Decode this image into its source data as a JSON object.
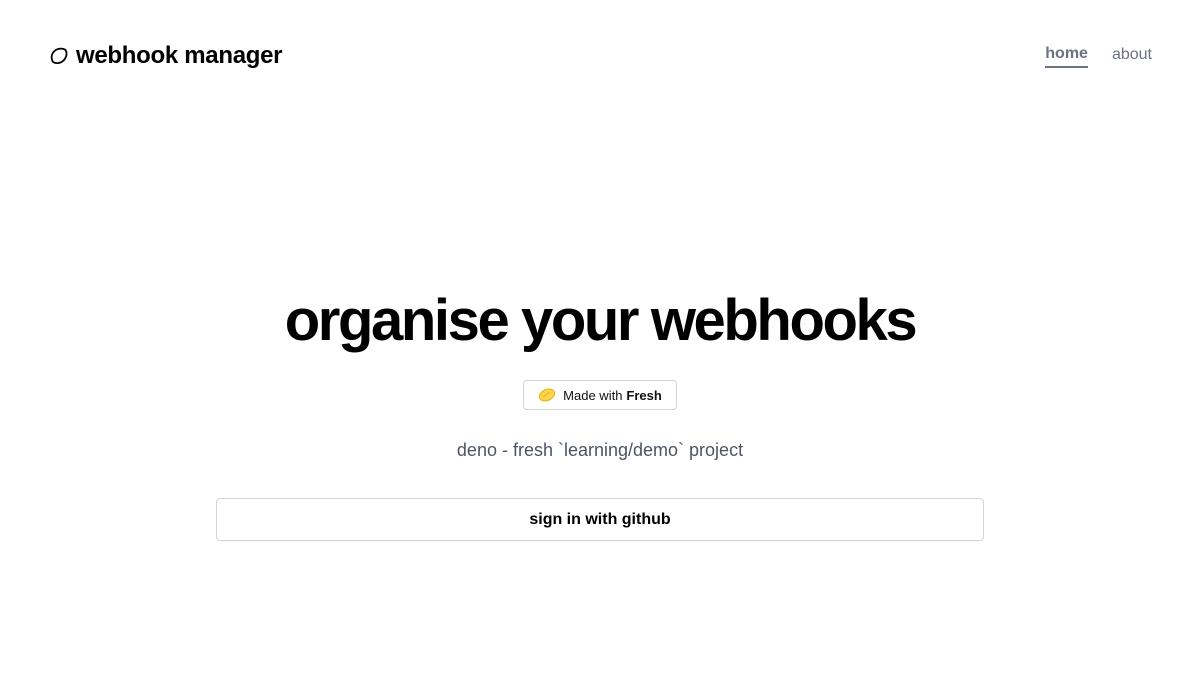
{
  "header": {
    "brand_title": "webhook manager",
    "brand_icon": "lemon-outline-icon",
    "nav": [
      {
        "label": "home",
        "active": true
      },
      {
        "label": "about",
        "active": false
      }
    ]
  },
  "hero": {
    "title": "organise your webhooks",
    "badge": {
      "prefix": "Made with",
      "brand": "Fresh",
      "icon": "fresh-lemon-icon"
    },
    "subtitle": "deno - fresh `learning/demo` project",
    "signin_label": "sign in with github"
  },
  "colors": {
    "text": "#000000",
    "muted": "#6b7280",
    "subtitle": "#4b5563",
    "border": "#d1d5db",
    "lemon": "#fcd34d"
  }
}
